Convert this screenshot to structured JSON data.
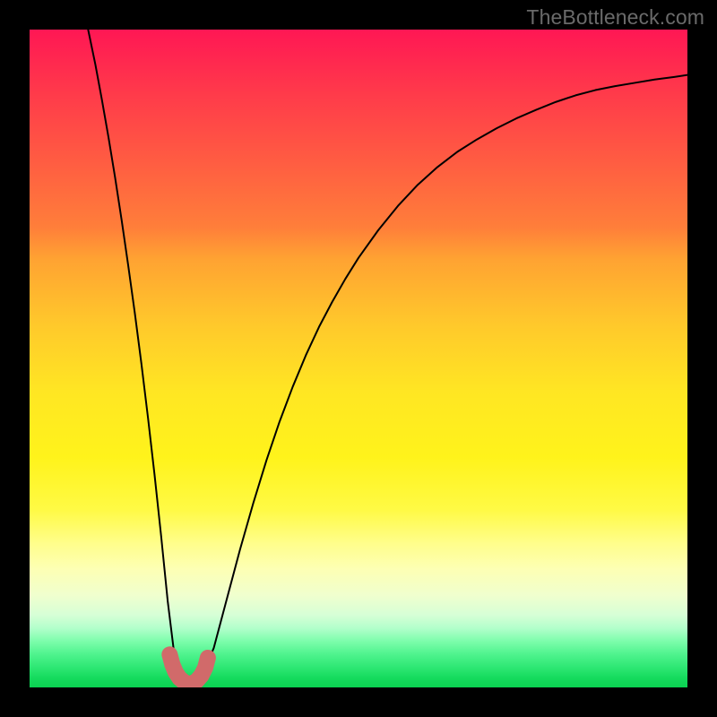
{
  "watermark": "TheBottleneck.com",
  "colors": {
    "frame_bg": "#000000",
    "curve": "#000000",
    "marker": "#d16a6a"
  },
  "chart_data": {
    "type": "line",
    "title": "",
    "xlabel": "",
    "ylabel": "",
    "xlim": [
      0,
      100
    ],
    "ylim": [
      0,
      100
    ],
    "curve": {
      "x": [
        8.9,
        10,
        11,
        12,
        13,
        14,
        15,
        16,
        17,
        18,
        19,
        20,
        21,
        22,
        23,
        24,
        25,
        26,
        28,
        30,
        32,
        34,
        36,
        38,
        40,
        42,
        44,
        46,
        48,
        50,
        53,
        56,
        59,
        62,
        65,
        68,
        71,
        74,
        77,
        80,
        83,
        86,
        89,
        92,
        95,
        98,
        100
      ],
      "values": [
        100,
        94.7,
        89.3,
        83.6,
        77.5,
        71.0,
        64.1,
        56.9,
        49.2,
        41.0,
        32.3,
        23.0,
        13.1,
        5.0,
        1.3,
        0.5,
        0.5,
        1.3,
        6.0,
        13.5,
        21.0,
        28.0,
        34.5,
        40.4,
        45.7,
        50.5,
        54.8,
        58.6,
        62.1,
        65.3,
        69.5,
        73.2,
        76.4,
        79.1,
        81.4,
        83.3,
        85.0,
        86.5,
        87.8,
        89.0,
        90.0,
        90.8,
        91.4,
        91.9,
        92.4,
        92.8,
        93.1
      ]
    },
    "marker_region": {
      "x": [
        21.3,
        21.7,
        22.2,
        22.8,
        23.4,
        24.0,
        24.7,
        25.4,
        26.1,
        26.7,
        27.1
      ],
      "values": [
        5.0,
        3.5,
        2.3,
        1.4,
        0.9,
        0.5,
        0.6,
        1.0,
        1.8,
        3.0,
        4.5
      ]
    }
  }
}
